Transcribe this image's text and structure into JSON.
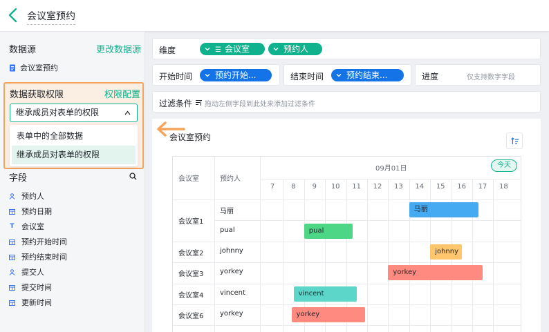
{
  "header": {
    "title": "会议室预约"
  },
  "sidebar": {
    "datasource": {
      "title": "数据源",
      "change_link": "更改数据源",
      "item": "会议室预约"
    },
    "permission": {
      "title": "数据获取权限",
      "config_link": "权限配置",
      "selected": "继承成员对表单的权限",
      "options": [
        "表单中的全部数据",
        "继承成员对表单的权限"
      ]
    },
    "fields": {
      "title": "字段",
      "items": [
        {
          "label": "预约人",
          "icon": "user-icon"
        },
        {
          "label": "预约日期",
          "icon": "calendar-icon"
        },
        {
          "label": "会议室",
          "icon": "text-icon"
        },
        {
          "label": "预约开始时间",
          "icon": "calendar-icon"
        },
        {
          "label": "预约结束时间",
          "icon": "calendar-icon"
        },
        {
          "label": "提交人",
          "icon": "user-icon"
        },
        {
          "label": "提交时间",
          "icon": "calendar-icon"
        },
        {
          "label": "更新时间",
          "icon": "calendar-icon"
        }
      ]
    }
  },
  "config": {
    "dimension": {
      "label": "维度",
      "pills": [
        "会议室",
        "预约人"
      ]
    },
    "start": {
      "label": "开始时间",
      "pill": "预约开始..."
    },
    "end": {
      "label": "结束时间",
      "pill": "预约结束..."
    },
    "progress": {
      "label": "进度",
      "hint": "仅支持数字字段"
    },
    "filter": {
      "label": "过滤条件",
      "hint": "拖动左侧字段到此处来添加过滤条件"
    }
  },
  "chart": {
    "title": "会议室预约",
    "col_room": "会议室",
    "col_person": "预约人",
    "date": "09月01日",
    "today": "今天",
    "hours": [
      "7",
      "8",
      "9",
      "10",
      "11",
      "12",
      "13",
      "14",
      "15",
      "16",
      "17",
      "18"
    ],
    "rows": [
      {
        "room": "会议室1",
        "person": "马丽"
      },
      {
        "room": "",
        "person": "pual"
      },
      {
        "room": "会议室2",
        "person": "johnny"
      },
      {
        "room": "会议室3",
        "person": "yorkey"
      },
      {
        "room": "会议室4",
        "person": "vincent"
      },
      {
        "room": "会议室6",
        "person": "yorkey"
      }
    ],
    "bars": [
      {
        "row": 0,
        "label": "马丽",
        "start": 14,
        "end": 17.3,
        "color": "#45aaf2"
      },
      {
        "row": 1,
        "label": "pual",
        "start": 9,
        "end": 11.3,
        "color": "#4cd685"
      },
      {
        "row": 2,
        "label": "johnny",
        "start": 15,
        "end": 16.5,
        "color": "#ffc66d"
      },
      {
        "row": 3,
        "label": "yorkey",
        "start": 13,
        "end": 17.5,
        "color": "#ff8a80"
      },
      {
        "row": 4,
        "label": "vincent",
        "start": 8.5,
        "end": 11.5,
        "color": "#5cd6c9"
      },
      {
        "row": 5,
        "label": "yorkey",
        "start": 8.4,
        "end": 11.9,
        "color": "#ff8a80"
      }
    ]
  }
}
